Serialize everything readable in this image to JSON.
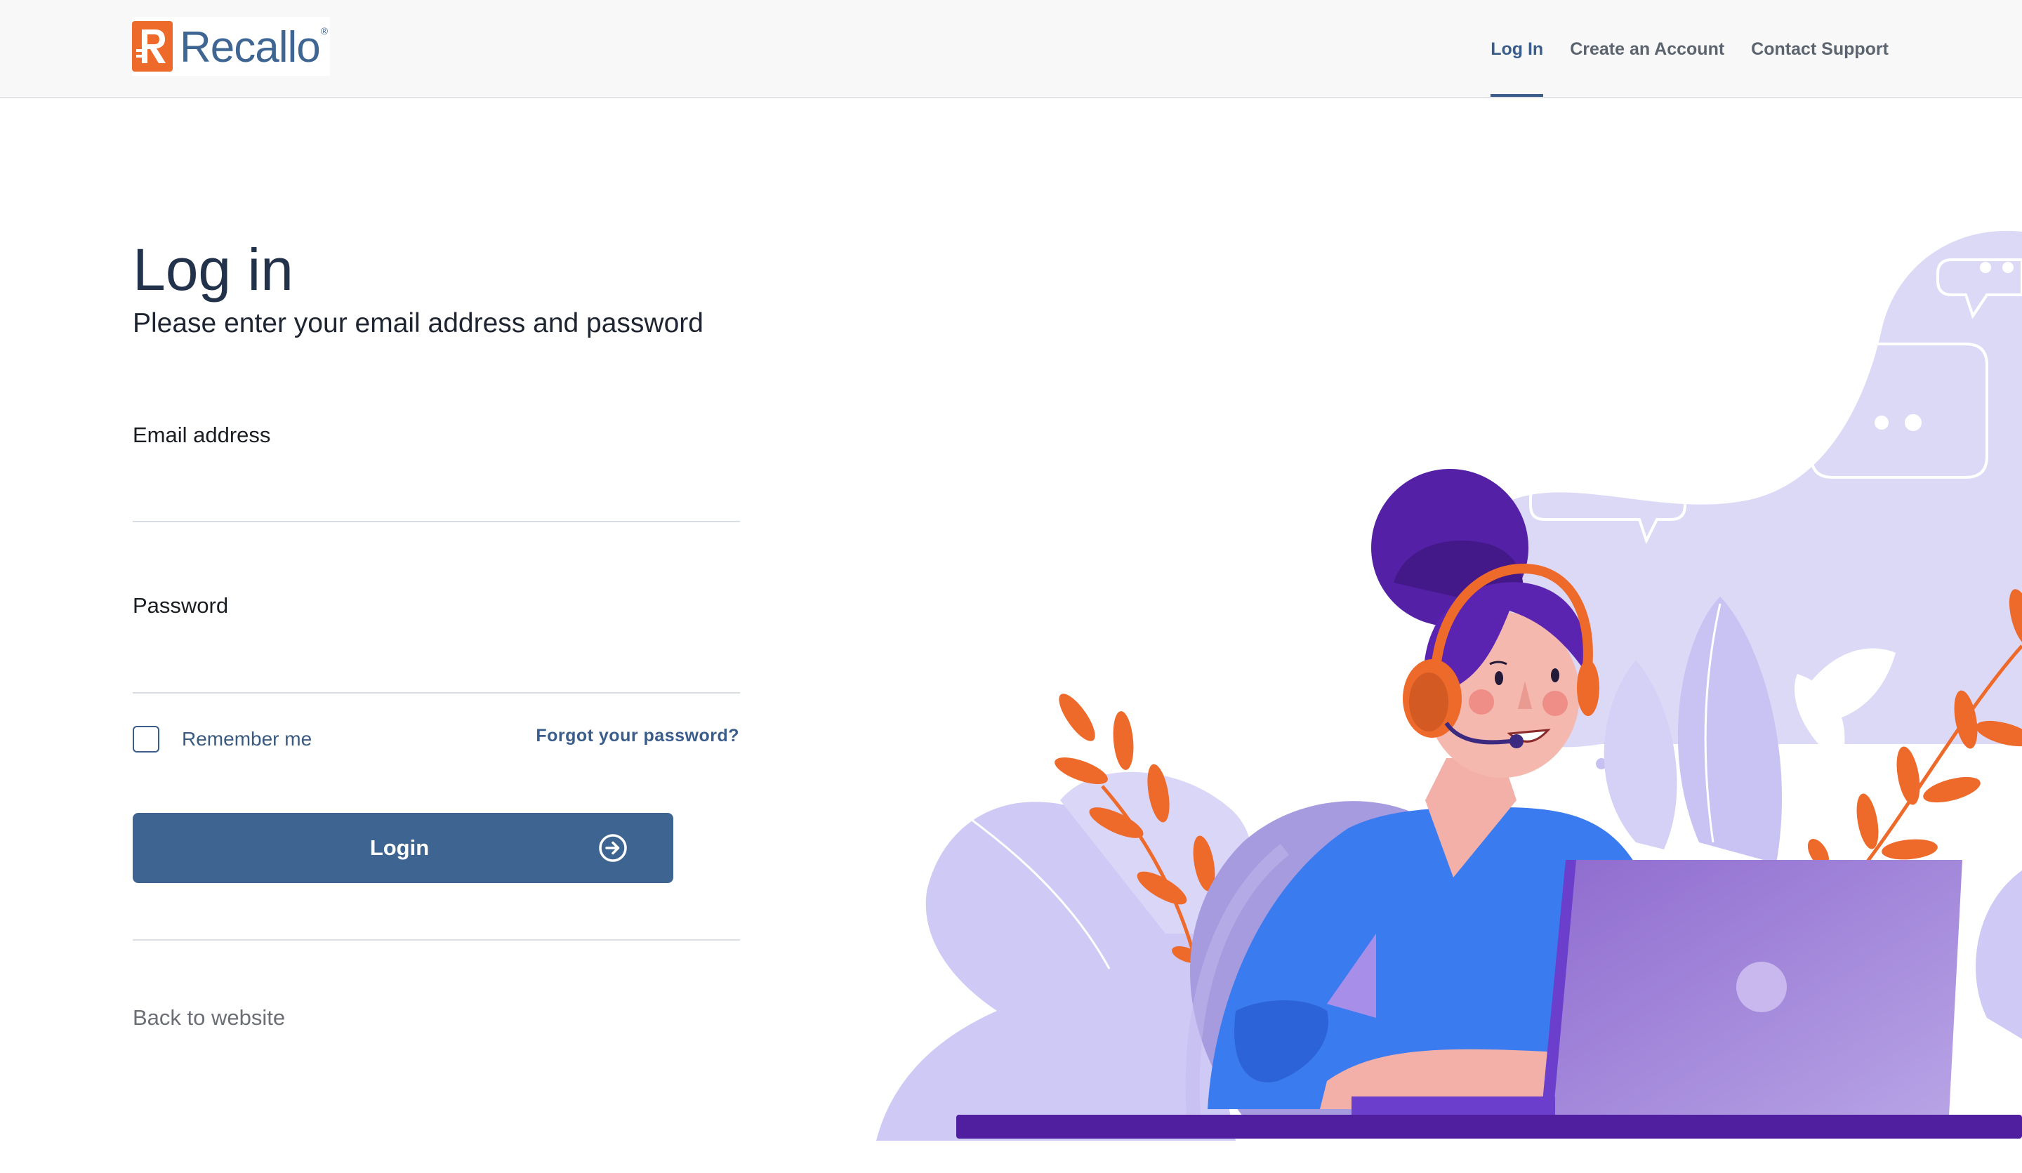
{
  "header": {
    "logo_text": "Recallo",
    "logo_reg": "®",
    "nav": [
      {
        "label": "Log In",
        "active": true
      },
      {
        "label": "Create an Account",
        "active": false
      },
      {
        "label": "Contact Support",
        "active": false
      }
    ]
  },
  "form": {
    "title": "Log in",
    "subtitle": "Please enter your email address and password",
    "email_label": "Email address",
    "email_value": "",
    "password_label": "Password",
    "password_value": "",
    "remember_label": "Remember me",
    "remember_checked": false,
    "forgot_label": "Forgot your password?",
    "login_label": "Login",
    "back_label": "Back to website"
  },
  "colors": {
    "brand_orange": "#ee6a2b",
    "brand_blue": "#3e6592",
    "illustration_lavender": "#dcd9f7",
    "illustration_purple": "#4f1fa0",
    "illustration_blue": "#3b7bf0"
  },
  "icons": {
    "logo": "recallo-r-logo-icon",
    "login_arrow": "arrow-right-circle-icon"
  }
}
